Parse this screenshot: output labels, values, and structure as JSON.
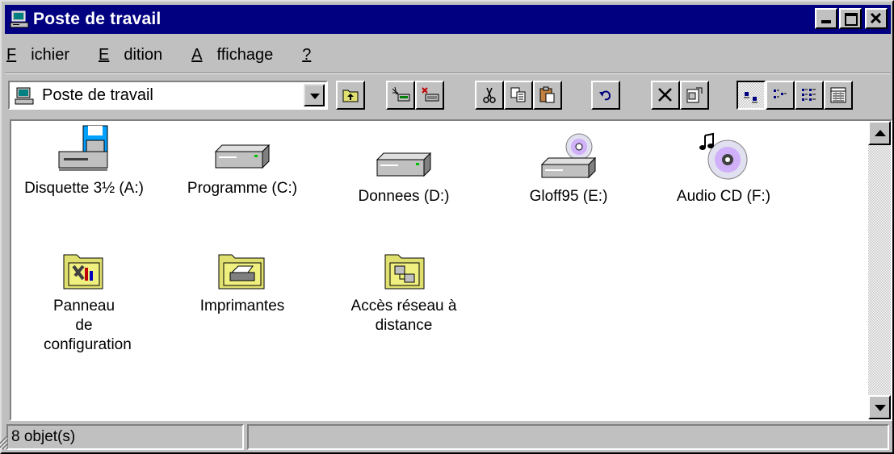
{
  "window": {
    "title": "Poste de travail"
  },
  "menu": [
    {
      "label": "Fichier"
    },
    {
      "label": "Edition"
    },
    {
      "label": "Affichage"
    },
    {
      "label": "?"
    }
  ],
  "address": {
    "value": "Poste de travail"
  },
  "items": [
    {
      "label": "Disquette 3½ (A:)",
      "icon": "floppy-drive-icon"
    },
    {
      "label": "Programme (C:)",
      "icon": "hard-drive-icon"
    },
    {
      "label": "Donnees (D:)",
      "icon": "hard-drive-icon"
    },
    {
      "label": "Gloff95 (E:)",
      "icon": "cd-drive-icon"
    },
    {
      "label": "Audio CD (F:)",
      "icon": "audio-cd-icon"
    },
    {
      "label": "Panneau de configuration",
      "icon": "control-panel-icon"
    },
    {
      "label": "Imprimantes",
      "icon": "printers-folder-icon"
    },
    {
      "label": "Accès réseau à distance",
      "icon": "dial-up-networking-icon"
    }
  ],
  "status": {
    "count": "8 objet(s)"
  },
  "colors": {
    "titlebar": "#000080",
    "face": "#c0c0c0",
    "folder": "#e0e070"
  }
}
